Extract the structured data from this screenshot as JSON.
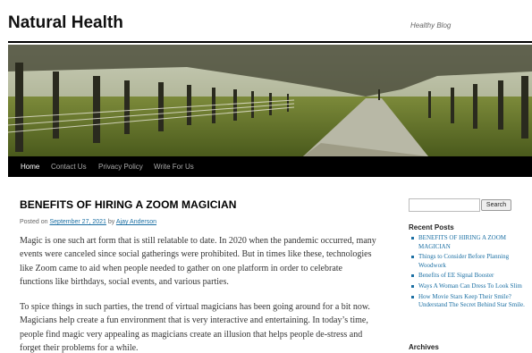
{
  "site": {
    "title": "Natural Health",
    "tagline": "Healthy Blog"
  },
  "nav": {
    "items": [
      {
        "label": "Home",
        "active": true
      },
      {
        "label": "Contact Us",
        "active": false
      },
      {
        "label": "Privacy Policy",
        "active": false
      },
      {
        "label": "Write For Us",
        "active": false
      }
    ]
  },
  "post": {
    "title": "BENEFITS OF HIRING A ZOOM MAGICIAN",
    "meta_prefix": "Posted on",
    "date": "September 27, 2021",
    "by": "by",
    "author": "Ajay Anderson",
    "paragraphs": [
      "Magic is one such art form that is still relatable to date. In 2020 when the pandemic occurred, many events were canceled since social gatherings were prohibited. But in times like these, technologies like Zoom came to aid when people needed to gather on one platform in order to celebrate functions like birthdays, social events, and various parties.",
      "To spice things in such parties, the trend of virtual magicians has been going around for a bit now. Magicians help create a fun environment that is very interactive and entertaining. In today’s time, people find magic very appealing as magicians create an illusion that helps people de-stress and forget their problems for a while."
    ]
  },
  "sidebar": {
    "search": {
      "value": "",
      "button_label": "Search"
    },
    "recent_posts_title": "Recent Posts",
    "recent_posts": [
      "BENEFITS OF HIRING A ZOOM MAGICIAN",
      "Things to Consider Before Planning Woodwork",
      "Benefits of EE Signal Booster",
      "Ways A Woman Can Dress To Look Slim",
      "How Movie Stars Keep Their Smile? Understand The Secret Behind Star Smile."
    ],
    "archives_title": "Archives"
  },
  "colors": {
    "link": "#1b6fa3",
    "nav_bg": "#000000",
    "text": "#333333"
  }
}
